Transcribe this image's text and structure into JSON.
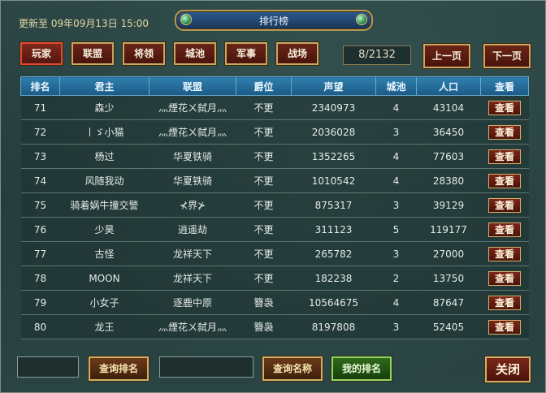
{
  "header": {
    "updated_text": "更新至 09年09月13日 15:00",
    "title": "排行榜"
  },
  "tabs": [
    {
      "label": "玩家",
      "active": true
    },
    {
      "label": "联盟",
      "active": false
    },
    {
      "label": "将领",
      "active": false
    },
    {
      "label": "城池",
      "active": false
    },
    {
      "label": "军事",
      "active": false
    },
    {
      "label": "战场",
      "active": false
    }
  ],
  "pager": {
    "text": "8/2132",
    "prev_label": "上一页",
    "next_label": "下一页"
  },
  "table": {
    "columns": [
      "排名",
      "君主",
      "联盟",
      "爵位",
      "声望",
      "城池",
      "人口",
      "查看"
    ],
    "view_label": "查看",
    "rows": [
      [
        "71",
        "森少",
        "灬煙花ㄨ弑月灬",
        "不更",
        "2340973",
        "4",
        "43104"
      ],
      [
        "72",
        "丨ゞ小猫",
        "灬煙花ㄨ弑月灬",
        "不更",
        "2036028",
        "3",
        "36450"
      ],
      [
        "73",
        "杨过",
        "华夏铁骑",
        "不更",
        "1352265",
        "4",
        "77603"
      ],
      [
        "74",
        "风随我动",
        "华夏铁骑",
        "不更",
        "1010542",
        "4",
        "28380"
      ],
      [
        "75",
        "骑着娲牛撞交警",
        "⊀界⊁",
        "不更",
        "875317",
        "3",
        "39129"
      ],
      [
        "76",
        "少昊",
        "逍遥劫",
        "不更",
        "311123",
        "5",
        "119177"
      ],
      [
        "77",
        "古怪",
        "龙祥天下",
        "不更",
        "265782",
        "3",
        "27000"
      ],
      [
        "78",
        "MOON",
        "龙祥天下",
        "不更",
        "182238",
        "2",
        "13750"
      ],
      [
        "79",
        "小女子",
        "逐鹿中原",
        "簪袅",
        "10564675",
        "4",
        "87647"
      ],
      [
        "80",
        "龙王",
        "灬煙花ㄨ弑月灬",
        "簪袅",
        "8197808",
        "3",
        "52405"
      ]
    ]
  },
  "footer": {
    "rank_input_value": "",
    "query_rank_label": "查询排名",
    "name_input_value": "",
    "query_name_label": "查询名称",
    "my_rank_label": "我的排名",
    "close_label": "关闭"
  }
}
